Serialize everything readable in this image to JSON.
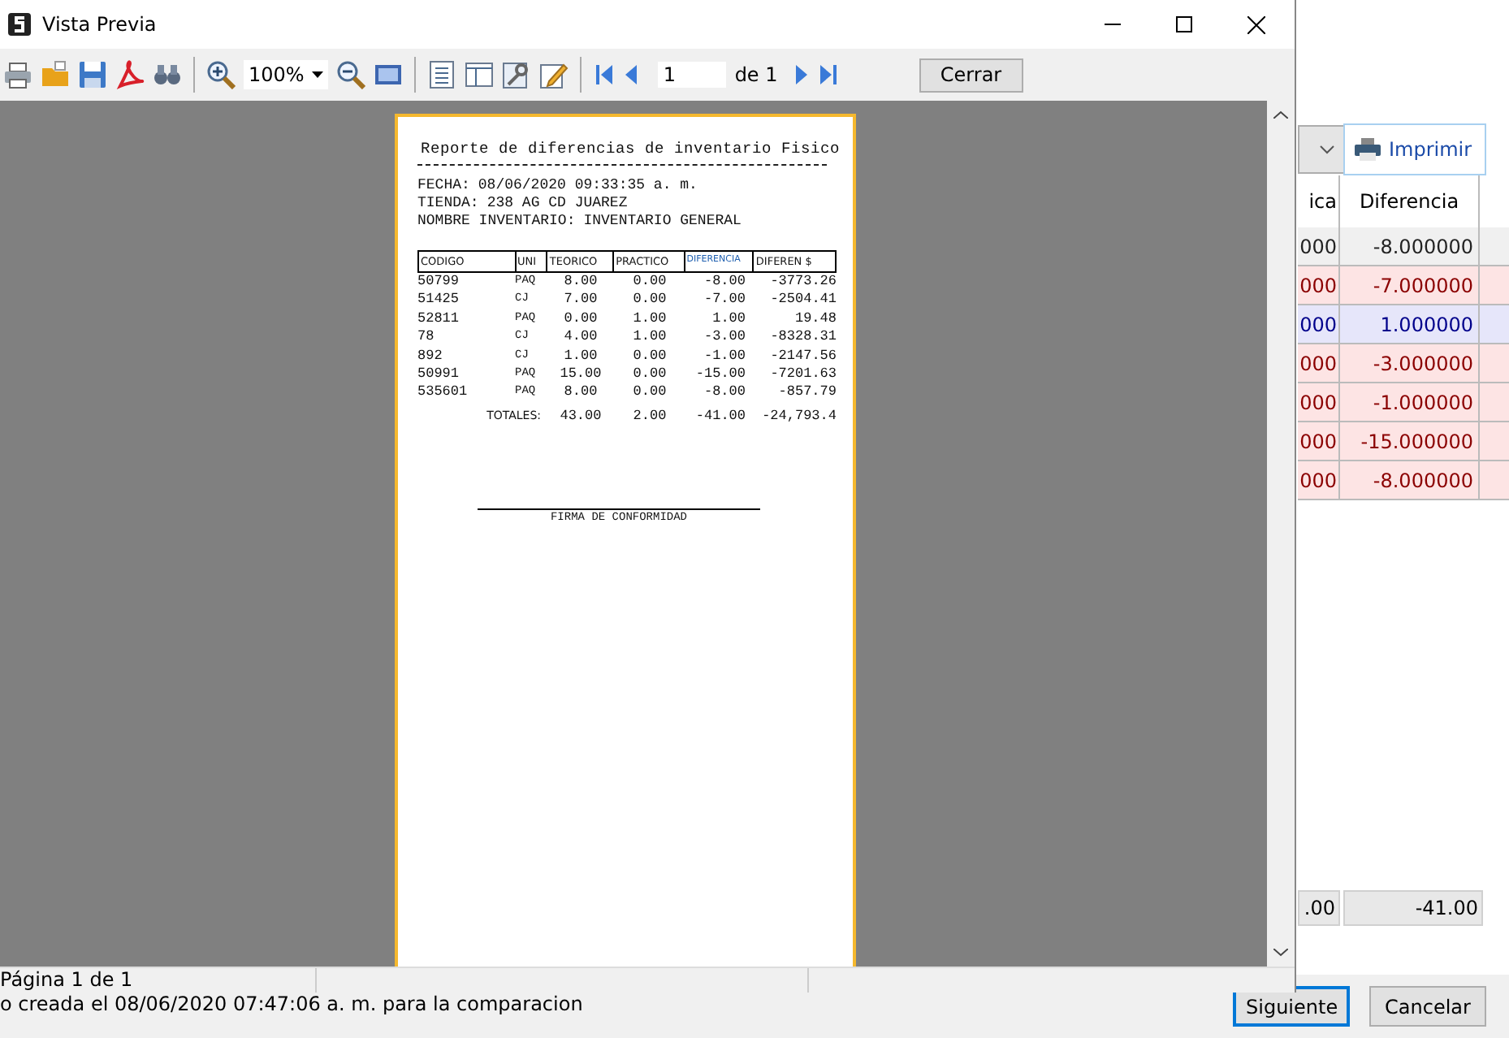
{
  "background": {
    "print_button": "Imprimir",
    "columns": [
      "ica",
      "Diferencia"
    ],
    "rows": [
      {
        "cells": [
          "000",
          "-8.000000"
        ],
        "kind": "negative",
        "selected": true
      },
      {
        "cells": [
          "000",
          "-7.000000"
        ],
        "kind": "negative",
        "selected": false
      },
      {
        "cells": [
          "000",
          "1.000000"
        ],
        "kind": "positive",
        "selected": false
      },
      {
        "cells": [
          "000",
          "-3.000000"
        ],
        "kind": "negative",
        "selected": false
      },
      {
        "cells": [
          "000",
          "-1.000000"
        ],
        "kind": "negative",
        "selected": false
      },
      {
        "cells": [
          "000",
          "-15.000000"
        ],
        "kind": "negative",
        "selected": false
      },
      {
        "cells": [
          "000",
          "-8.000000"
        ],
        "kind": "negative",
        "selected": false
      }
    ],
    "totals": [
      ".00",
      "-41.00"
    ],
    "message": "o creada el 08/06/2020 07:47:06 a. m. para la comparacion",
    "buttons": [
      {
        "label": "Siguiente",
        "selected": true
      },
      {
        "label": "Cancelar",
        "selected": false
      }
    ]
  },
  "preview_window": {
    "title": "Vista Previa",
    "zoom": "100%",
    "page_field": "1",
    "page_total": "de 1",
    "close_button": "Cerrar",
    "status": "Página 1 de 1"
  },
  "report": {
    "title": "Reporte de diferencias de inventario Fisico",
    "header_lines": [
      {
        "label": "FECHA:",
        "value": "08/06/2020 09:33:35 a. m."
      },
      {
        "label": "TIENDA:",
        "value": "238 AG CD JUAREZ"
      },
      {
        "label": "NOMBRE INVENTARIO:",
        "value": "INVENTARIO GENERAL"
      }
    ],
    "columns": [
      "CODIGO",
      "UNI",
      "TEORICO",
      "PRACTICO",
      "DIFERENCIA",
      "DIFEREN $"
    ],
    "rows": [
      [
        "50799",
        "PAQ",
        "8.00",
        "0.00",
        "-8.00",
        "-3773.26"
      ],
      [
        "51425",
        "CJ",
        "7.00",
        "0.00",
        "-7.00",
        "-2504.41"
      ],
      [
        "52811",
        "PAQ",
        "0.00",
        "1.00",
        "1.00",
        "19.48"
      ],
      [
        "78",
        "CJ",
        "4.00",
        "1.00",
        "-3.00",
        "-8328.31"
      ],
      [
        "892",
        "CJ",
        "1.00",
        "0.00",
        "-1.00",
        "-2147.56"
      ],
      [
        "50991",
        "PAQ",
        "15.00",
        "0.00",
        "-15.00",
        "-7201.63"
      ],
      [
        "535601",
        "PAQ",
        "8.00",
        "0.00",
        "-8.00",
        "-857.79"
      ]
    ],
    "totals": {
      "label": "TOTALES:",
      "values": [
        "43.00",
        "2.00",
        "-41.00",
        "-24,793.4"
      ]
    },
    "signature": "FIRMA DE CONFORMIDAD"
  }
}
